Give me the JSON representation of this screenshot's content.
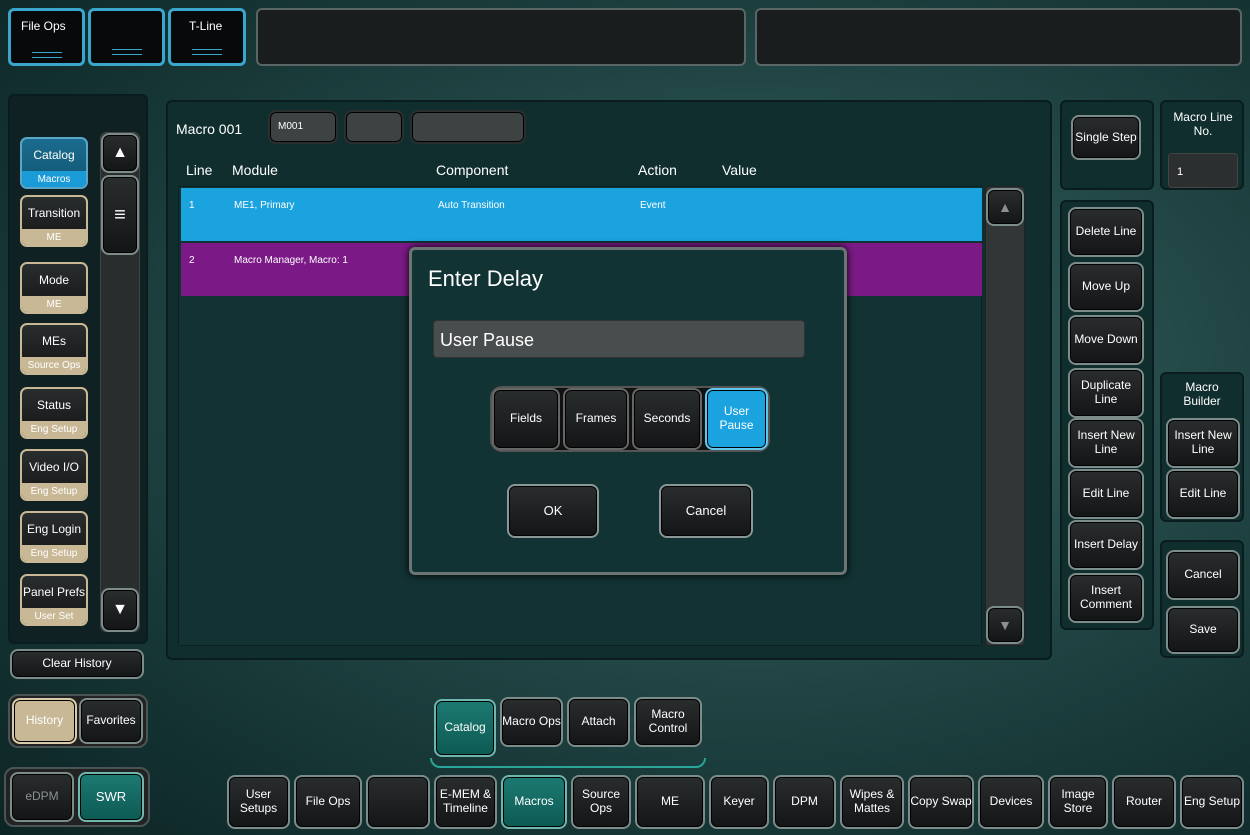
{
  "top_tabs": [
    {
      "label": "File Ops"
    },
    {
      "label": ""
    },
    {
      "label": "T-Line"
    }
  ],
  "sidebar": {
    "items": [
      {
        "label": "Catalog",
        "sub": "Macros",
        "active": true
      },
      {
        "label": "Transition",
        "sub": "ME"
      },
      {
        "label": "Mode",
        "sub": "ME"
      },
      {
        "label": "MEs",
        "sub": "Source Ops"
      },
      {
        "label": "Status",
        "sub": "Eng Setup"
      },
      {
        "label": "Video I/O",
        "sub": "Eng Setup"
      },
      {
        "label": "Eng Login",
        "sub": "Eng Setup"
      },
      {
        "label": "Panel Prefs",
        "sub": "User Set"
      }
    ],
    "clear_history": "Clear History",
    "history": "History",
    "favorites": "Favorites"
  },
  "macro": {
    "title": "Macro 001",
    "name": "M001"
  },
  "table": {
    "headers": {
      "line": "Line",
      "module": "Module",
      "component": "Component",
      "action": "Action",
      "value": "Value"
    },
    "rows": [
      {
        "line": "1",
        "module": "ME1, Primary",
        "component": "Auto Transition",
        "action": "Event",
        "value": ""
      },
      {
        "line": "2",
        "module": "Macro Manager, Macro: 1",
        "component": "",
        "action": "",
        "value": ""
      }
    ]
  },
  "dialog": {
    "title": "Enter Delay",
    "field_value": "User Pause",
    "units": [
      "Fields",
      "Frames",
      "Seconds",
      "User Pause"
    ],
    "selected_unit": "User Pause",
    "ok": "OK",
    "cancel": "Cancel"
  },
  "right": {
    "single_step": "Single Step",
    "macro_line_no_label": "Macro Line No.",
    "macro_line_no_value": "1",
    "delete_line": "Delete Line",
    "move_up": "Move Up",
    "move_down": "Move Down",
    "duplicate_line": "Duplicate Line",
    "insert_new_line": "Insert New Line",
    "edit_line": "Edit Line",
    "insert_delay": "Insert Delay",
    "insert_comment": "Insert Comment",
    "macro_builder_label": "Macro Builder",
    "mb_insert_new_line": "Insert New Line",
    "mb_edit_line": "Edit Line",
    "cancel": "Cancel",
    "save": "Save"
  },
  "subtabs": [
    {
      "label": "Catalog",
      "active": true
    },
    {
      "label": "Macro Ops"
    },
    {
      "label": "Attach"
    },
    {
      "label": "Macro Control"
    }
  ],
  "bottom": {
    "edpm": "eDPM",
    "swr": "SWR",
    "tabs": [
      "User Setups",
      "File Ops",
      "",
      "E-MEM & Timeline",
      "Macros",
      "Source Ops",
      "ME",
      "Keyer",
      "DPM",
      "Wipes & Mattes",
      "Copy Swap",
      "Devices",
      "Image Store",
      "Router",
      "Eng Setup"
    ],
    "active_tab": "Macros"
  },
  "colors": {
    "row_selected": "#1aa3de",
    "row_2": "#7b1a86",
    "accent_teal": "#0d5a54",
    "side_tan": "#c8b896"
  }
}
